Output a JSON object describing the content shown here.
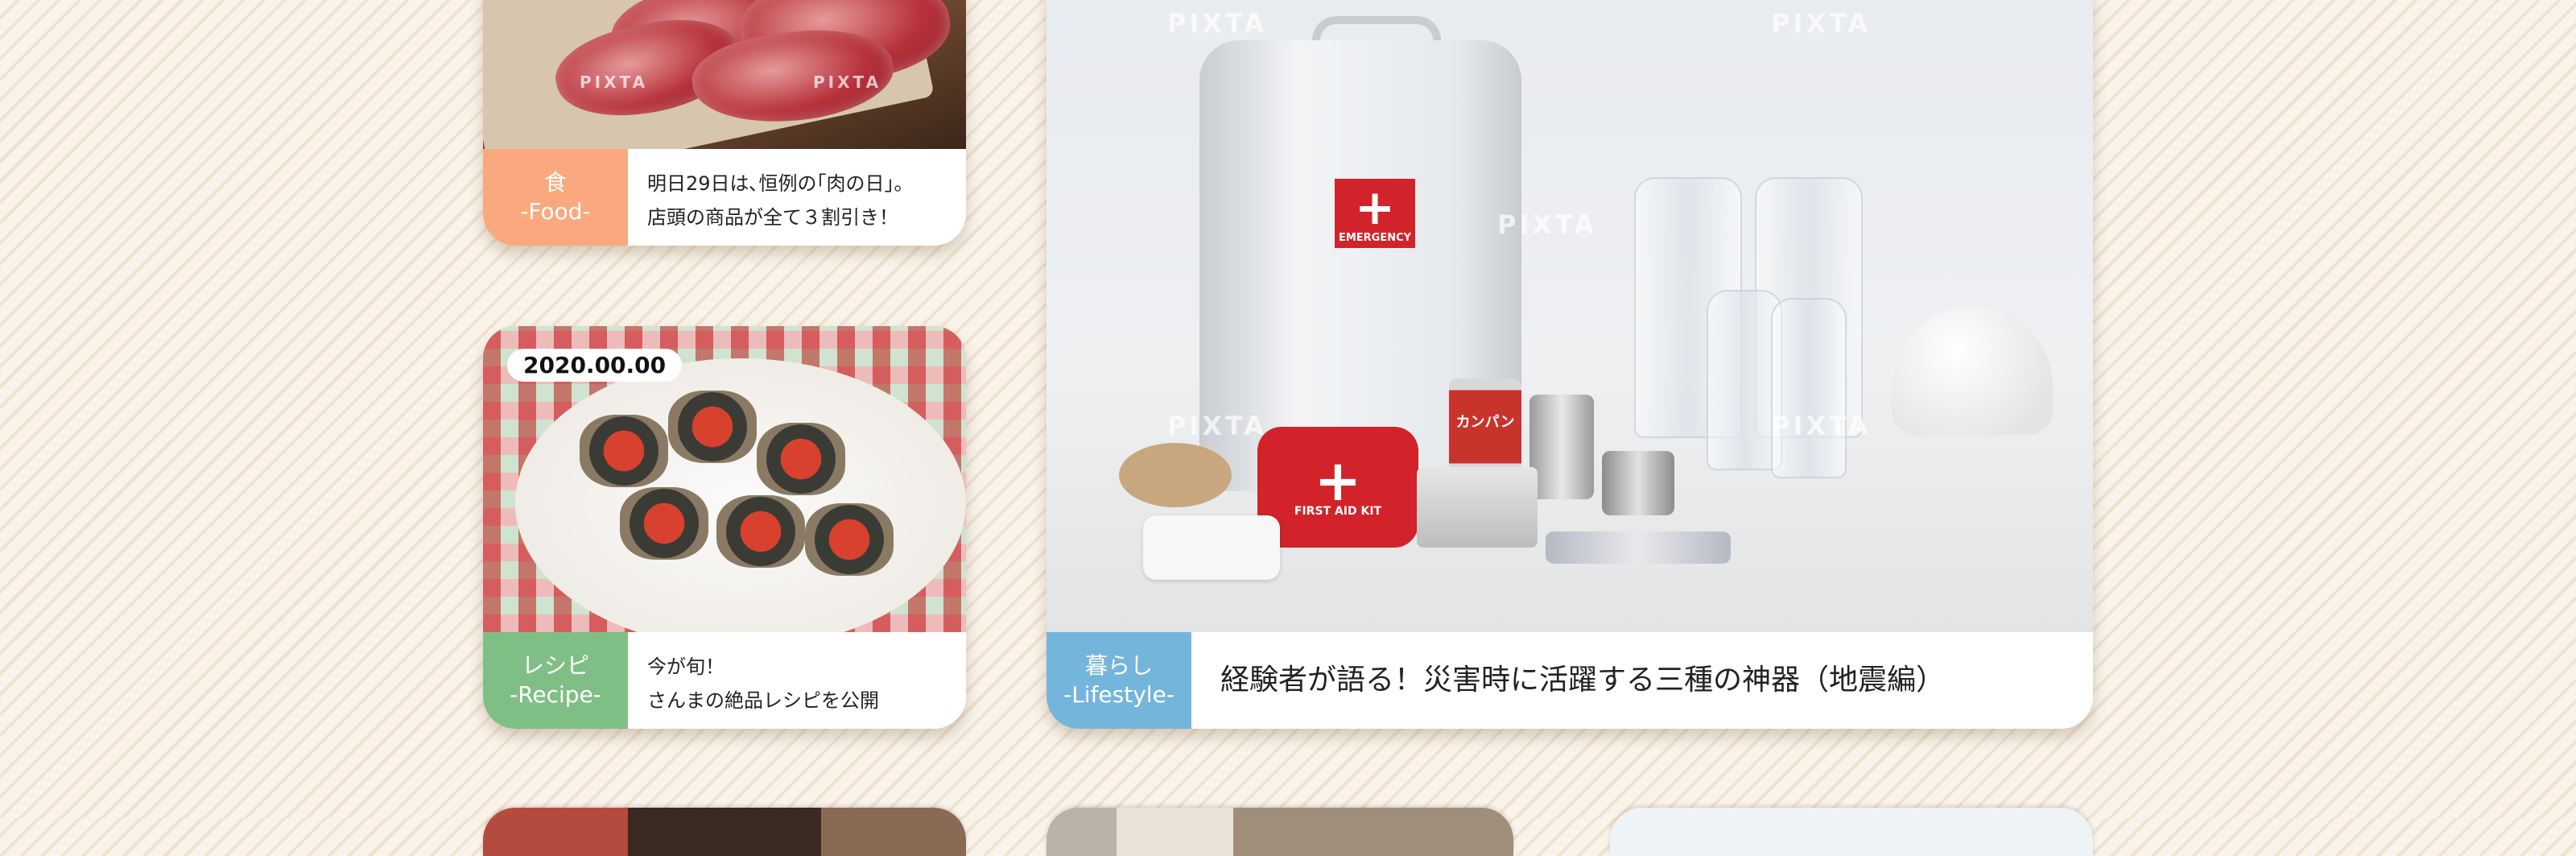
{
  "watermark": "PIXTA",
  "cards": {
    "food": {
      "category_jp": "食",
      "category_en": "-Food-",
      "text_line1": "明日29日は､恒例の｢肉の日｣。",
      "text_line2": "店頭の商品が全て３割引き！"
    },
    "recipe": {
      "date": "2020.00.00",
      "category_jp": "レシピ",
      "category_en": "-Recipe-",
      "text_line1": "今が旬！",
      "text_line2": "さんまの絶品レシピを公開"
    },
    "lifestyle": {
      "category_jp": "暮らし",
      "category_en": "-Lifestyle-",
      "title": "経験者が語る！災害時に活躍する三種の神器（地震編）",
      "bag_label": "EMERGENCY",
      "kit_label": "FIRST AID KIT",
      "can_label": "カンパン"
    }
  },
  "colors": {
    "food": "#f9a97d",
    "recipe": "#7fbf86",
    "lifestyle": "#74b5dc",
    "background": "#f6eee3"
  }
}
